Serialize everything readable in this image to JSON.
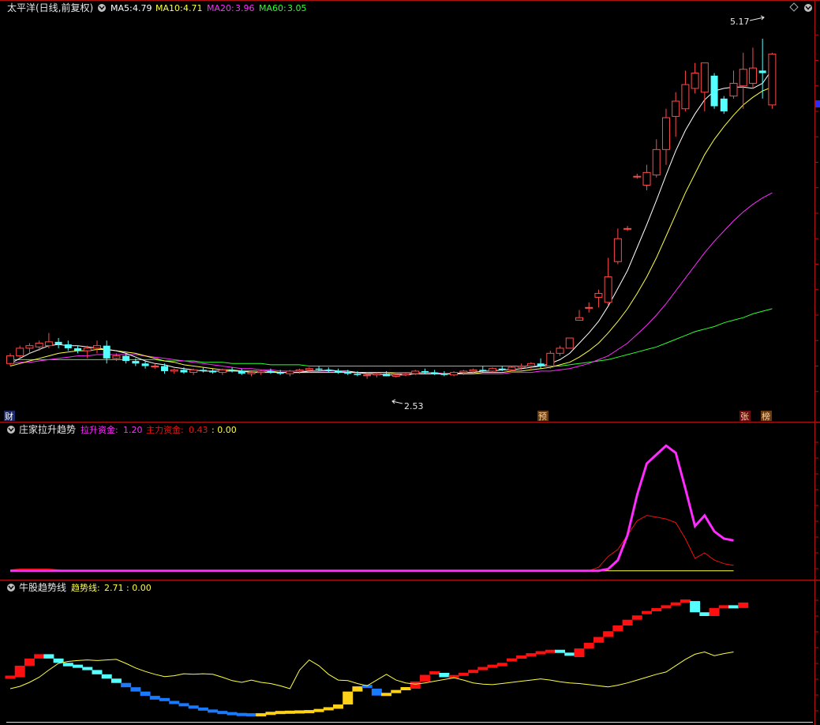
{
  "colors": {
    "up": "#ff4a4a",
    "down": "#54ffff",
    "ma5": "#ffffff",
    "ma10": "#ffff40",
    "ma20": "#ff2bff",
    "ma60": "#2bff2b",
    "grid": "#b01010",
    "pull": "#ff2bff",
    "main": "#ee1111",
    "zero": "#ffff40",
    "trend": "#ffff40"
  },
  "main_panel": {
    "title": "太平洋(日线,前复权)",
    "ma5_label": "MA5:",
    "ma5_value": "4.79",
    "ma10_label": "MA10:",
    "ma10_value": "4.71",
    "ma20_label": "MA20:",
    "ma20_value": "3.96",
    "ma60_label": "MA60:",
    "ma60_value": "3.05",
    "high_annotation": "5.17",
    "low_annotation": "2.53",
    "badge_cai": "财",
    "badge_yu": "预",
    "badge_zhang": "张",
    "badge_bang": "榜"
  },
  "indicator1": {
    "title": "庄家拉升趋势",
    "pull_label": "拉升资金:",
    "pull_value": "1.20",
    "main_label": "主力资金:",
    "main_value": "0.43",
    "zero_text": ": 0.00"
  },
  "indicator2": {
    "title": "牛股趋势线",
    "trend_label": "趋势线:",
    "trend_value": "2.71",
    "zero_text": ": 0.00"
  },
  "chart_data": [
    {
      "type": "candlestick",
      "title": "太平洋(日线,前复权)",
      "ylim": [
        2.2,
        5.35
      ],
      "ohlc": [
        [
          2.62,
          2.7,
          2.6,
          2.68
        ],
        [
          2.68,
          2.76,
          2.66,
          2.74
        ],
        [
          2.74,
          2.78,
          2.7,
          2.76
        ],
        [
          2.75,
          2.8,
          2.72,
          2.78
        ],
        [
          2.76,
          2.86,
          2.74,
          2.79
        ],
        [
          2.79,
          2.82,
          2.74,
          2.77
        ],
        [
          2.77,
          2.8,
          2.72,
          2.74
        ],
        [
          2.74,
          2.76,
          2.7,
          2.72
        ],
        [
          2.72,
          2.76,
          2.66,
          2.74
        ],
        [
          2.74,
          2.8,
          2.7,
          2.76
        ],
        [
          2.76,
          2.8,
          2.62,
          2.66
        ],
        [
          2.66,
          2.7,
          2.64,
          2.68
        ],
        [
          2.68,
          2.7,
          2.62,
          2.64
        ],
        [
          2.64,
          2.66,
          2.6,
          2.62
        ],
        [
          2.62,
          2.64,
          2.58,
          2.6
        ],
        [
          2.6,
          2.62,
          2.58,
          2.6
        ],
        [
          2.6,
          2.62,
          2.54,
          2.56
        ],
        [
          2.56,
          2.58,
          2.54,
          2.57
        ],
        [
          2.57,
          2.59,
          2.54,
          2.55
        ],
        [
          2.55,
          2.58,
          2.53,
          2.57
        ],
        [
          2.57,
          2.59,
          2.55,
          2.56
        ],
        [
          2.56,
          2.58,
          2.54,
          2.55
        ],
        [
          2.55,
          2.58,
          2.53,
          2.57
        ],
        [
          2.57,
          2.59,
          2.55,
          2.56
        ],
        [
          2.56,
          2.58,
          2.53,
          2.54
        ],
        [
          2.54,
          2.56,
          2.52,
          2.55
        ],
        [
          2.55,
          2.57,
          2.53,
          2.56
        ],
        [
          2.56,
          2.58,
          2.54,
          2.55
        ],
        [
          2.55,
          2.57,
          2.53,
          2.54
        ],
        [
          2.54,
          2.57,
          2.52,
          2.56
        ],
        [
          2.56,
          2.58,
          2.54,
          2.57
        ],
        [
          2.57,
          2.59,
          2.55,
          2.58
        ],
        [
          2.58,
          2.6,
          2.56,
          2.57
        ],
        [
          2.57,
          2.59,
          2.55,
          2.56
        ],
        [
          2.56,
          2.58,
          2.54,
          2.55
        ],
        [
          2.55,
          2.57,
          2.53,
          2.54
        ],
        [
          2.54,
          2.56,
          2.52,
          2.53
        ],
        [
          2.53,
          2.55,
          2.5,
          2.53
        ],
        [
          2.53,
          2.55,
          2.51,
          2.54
        ],
        [
          2.54,
          2.56,
          2.52,
          2.52
        ],
        [
          2.52,
          2.54,
          2.51,
          2.53
        ],
        [
          2.53,
          2.55,
          2.52,
          2.54
        ],
        [
          2.54,
          2.57,
          2.53,
          2.56
        ],
        [
          2.56,
          2.58,
          2.54,
          2.55
        ],
        [
          2.55,
          2.57,
          2.53,
          2.54
        ],
        [
          2.54,
          2.56,
          2.52,
          2.53
        ],
        [
          2.53,
          2.56,
          2.52,
          2.55
        ],
        [
          2.55,
          2.57,
          2.53,
          2.56
        ],
        [
          2.56,
          2.58,
          2.54,
          2.57
        ],
        [
          2.57,
          2.6,
          2.55,
          2.56
        ],
        [
          2.56,
          2.59,
          2.55,
          2.58
        ],
        [
          2.58,
          2.6,
          2.56,
          2.57
        ],
        [
          2.57,
          2.6,
          2.56,
          2.59
        ],
        [
          2.59,
          2.62,
          2.57,
          2.6
        ],
        [
          2.6,
          2.63,
          2.58,
          2.62
        ],
        [
          2.62,
          2.66,
          2.58,
          2.6
        ],
        [
          2.6,
          2.72,
          2.58,
          2.7
        ],
        [
          2.7,
          2.76,
          2.68,
          2.74
        ],
        [
          2.74,
          2.82,
          2.74,
          2.82
        ],
        [
          2.96,
          3.04,
          2.96,
          2.98
        ],
        [
          3.06,
          3.1,
          3.02,
          3.06
        ],
        [
          3.14,
          3.2,
          3.06,
          3.17
        ],
        [
          3.1,
          3.45,
          3.08,
          3.3
        ],
        [
          3.42,
          3.68,
          3.4,
          3.6
        ],
        [
          3.68,
          3.7,
          3.66,
          3.68
        ],
        [
          4.09,
          4.11,
          4.07,
          4.09
        ],
        [
          4.02,
          4.18,
          3.98,
          4.12
        ],
        [
          4.1,
          4.38,
          4.08,
          4.3
        ],
        [
          4.3,
          4.62,
          4.18,
          4.55
        ],
        [
          4.56,
          4.75,
          4.4,
          4.68
        ],
        [
          4.62,
          4.92,
          4.6,
          4.81
        ],
        [
          4.78,
          4.98,
          4.74,
          4.9
        ],
        [
          4.75,
          4.95,
          4.6,
          4.98
        ],
        [
          4.88,
          4.9,
          4.62,
          4.64
        ],
        [
          4.7,
          4.72,
          4.58,
          4.6
        ],
        [
          4.72,
          4.92,
          4.7,
          4.82
        ],
        [
          4.8,
          5.06,
          4.62,
          4.93
        ],
        [
          4.82,
          5.1,
          4.78,
          4.94
        ],
        [
          4.92,
          5.17,
          4.7,
          4.9
        ],
        [
          4.65,
          5.06,
          4.62,
          5.05
        ]
      ],
      "ma5": [
        2.62,
        2.66,
        2.7,
        2.73,
        2.76,
        2.77,
        2.76,
        2.76,
        2.75,
        2.74,
        2.73,
        2.72,
        2.7,
        2.67,
        2.64,
        2.62,
        2.61,
        2.59,
        2.58,
        2.57,
        2.56,
        2.56,
        2.56,
        2.56,
        2.56,
        2.55,
        2.55,
        2.55,
        2.55,
        2.55,
        2.55,
        2.56,
        2.56,
        2.57,
        2.56,
        2.56,
        2.55,
        2.54,
        2.54,
        2.53,
        2.53,
        2.53,
        2.54,
        2.54,
        2.54,
        2.54,
        2.54,
        2.55,
        2.55,
        2.56,
        2.56,
        2.57,
        2.57,
        2.58,
        2.59,
        2.6,
        2.62,
        2.65,
        2.7,
        2.78,
        2.86,
        2.95,
        3.07,
        3.21,
        3.35,
        3.53,
        3.71,
        3.9,
        4.1,
        4.29,
        4.45,
        4.58,
        4.69,
        4.76,
        4.78,
        4.79,
        4.79,
        4.78,
        4.82,
        4.93
      ],
      "ma10": [
        2.6,
        2.62,
        2.64,
        2.66,
        2.68,
        2.7,
        2.71,
        2.72,
        2.72,
        2.73,
        2.73,
        2.72,
        2.71,
        2.7,
        2.68,
        2.66,
        2.64,
        2.63,
        2.61,
        2.6,
        2.59,
        2.58,
        2.57,
        2.57,
        2.56,
        2.56,
        2.56,
        2.56,
        2.55,
        2.55,
        2.55,
        2.55,
        2.55,
        2.55,
        2.55,
        2.55,
        2.55,
        2.55,
        2.55,
        2.55,
        2.54,
        2.54,
        2.54,
        2.54,
        2.54,
        2.54,
        2.54,
        2.54,
        2.54,
        2.55,
        2.55,
        2.55,
        2.56,
        2.56,
        2.57,
        2.58,
        2.59,
        2.61,
        2.63,
        2.67,
        2.72,
        2.78,
        2.86,
        2.95,
        3.05,
        3.17,
        3.3,
        3.45,
        3.62,
        3.79,
        3.96,
        4.11,
        4.26,
        4.38,
        4.48,
        4.57,
        4.65,
        4.71,
        4.76,
        4.79
      ],
      "ma20": [
        2.62,
        2.63,
        2.63,
        2.64,
        2.65,
        2.66,
        2.67,
        2.68,
        2.68,
        2.69,
        2.69,
        2.69,
        2.69,
        2.69,
        2.68,
        2.67,
        2.66,
        2.65,
        2.64,
        2.63,
        2.62,
        2.61,
        2.6,
        2.59,
        2.58,
        2.58,
        2.57,
        2.57,
        2.56,
        2.56,
        2.56,
        2.56,
        2.56,
        2.56,
        2.56,
        2.55,
        2.55,
        2.55,
        2.55,
        2.55,
        2.55,
        2.55,
        2.55,
        2.55,
        2.55,
        2.54,
        2.54,
        2.54,
        2.54,
        2.54,
        2.54,
        2.54,
        2.55,
        2.55,
        2.55,
        2.56,
        2.56,
        2.57,
        2.58,
        2.6,
        2.62,
        2.65,
        2.68,
        2.73,
        2.78,
        2.85,
        2.92,
        3.0,
        3.09,
        3.19,
        3.29,
        3.39,
        3.49,
        3.58,
        3.66,
        3.74,
        3.81,
        3.87,
        3.92,
        3.96
      ],
      "ma60": [
        2.65,
        2.65,
        2.65,
        2.65,
        2.65,
        2.65,
        2.65,
        2.65,
        2.65,
        2.65,
        2.65,
        2.65,
        2.65,
        2.65,
        2.65,
        2.65,
        2.64,
        2.64,
        2.64,
        2.64,
        2.63,
        2.63,
        2.63,
        2.62,
        2.62,
        2.62,
        2.62,
        2.61,
        2.61,
        2.61,
        2.61,
        2.6,
        2.6,
        2.6,
        2.6,
        2.6,
        2.6,
        2.6,
        2.6,
        2.6,
        2.6,
        2.6,
        2.6,
        2.6,
        2.6,
        2.6,
        2.6,
        2.6,
        2.6,
        2.6,
        2.6,
        2.6,
        2.6,
        2.6,
        2.6,
        2.6,
        2.6,
        2.6,
        2.61,
        2.62,
        2.63,
        2.64,
        2.65,
        2.67,
        2.69,
        2.71,
        2.73,
        2.75,
        2.78,
        2.81,
        2.84,
        2.87,
        2.89,
        2.91,
        2.94,
        2.96,
        2.98,
        3.01,
        3.03,
        3.05
      ]
    },
    {
      "type": "line",
      "title": "庄家拉升趋势",
      "ylim": [
        -0.02,
        1.5
      ],
      "series": [
        {
          "name": "拉升资金",
          "values": [
            0,
            0,
            0,
            0,
            0,
            0,
            0,
            0,
            0,
            0,
            0,
            0,
            0,
            0,
            0,
            0,
            0,
            0,
            0,
            0,
            0,
            0,
            0,
            0,
            0,
            0,
            0,
            0,
            0,
            0,
            0,
            0,
            0,
            0,
            0,
            0,
            0,
            0,
            0,
            0,
            0,
            0,
            0,
            0,
            0,
            0,
            0,
            0,
            0,
            0,
            0,
            0,
            0,
            0,
            0,
            0,
            0,
            0,
            0,
            0,
            0,
            0,
            0.02,
            0.12,
            0.4,
            0.85,
            1.2,
            1.3,
            1.4,
            1.32,
            0.92,
            0.5,
            0.62,
            0.44,
            0.36,
            0.34
          ]
        },
        {
          "name": "主力资金",
          "values": [
            0.01,
            0.02,
            0.02,
            0.02,
            0.02,
            0.01,
            0,
            0,
            0,
            0,
            0,
            0,
            0,
            0,
            0,
            0,
            0,
            0,
            0,
            0,
            0,
            0,
            0,
            0,
            0,
            0,
            0,
            0,
            0,
            0,
            0,
            0,
            0,
            0,
            0,
            0,
            0,
            0,
            0,
            0,
            0,
            0,
            0,
            0,
            0,
            0,
            0,
            0,
            0,
            0,
            0,
            0,
            0,
            0,
            0,
            0,
            0,
            0,
            0,
            0,
            0,
            0.04,
            0.16,
            0.24,
            0.4,
            0.56,
            0.62,
            0.6,
            0.58,
            0.54,
            0.36,
            0.14,
            0.2,
            0.12,
            0.08,
            0.06
          ]
        }
      ]
    },
    {
      "type": "bar+line",
      "title": "牛股趋势线",
      "ylim": [
        -1.2,
        3.2
      ],
      "bar_values": [
        0.3,
        0.7,
        0.95,
        1.1,
        0.95,
        0.8,
        0.68,
        0.6,
        0.55,
        0.4,
        0.25,
        0.1,
        -0.05,
        -0.2,
        -0.35,
        -0.48,
        -0.58,
        -0.66,
        -0.74,
        -0.81,
        -0.88,
        -0.93,
        -0.97,
        -1.0,
        -1.01,
        -1.02,
        -1.01,
        -0.96,
        -0.93,
        -0.92,
        -0.91,
        -0.9,
        -0.86,
        -0.8,
        -0.65,
        -0.2,
        -0.02,
        -0.1,
        -0.34,
        -0.3,
        -0.2,
        -0.1,
        0.15,
        0.38,
        0.45,
        0.3,
        0.32,
        0.4,
        0.5,
        0.6,
        0.68,
        0.8,
        0.9,
        1.0,
        1.08,
        1.15,
        1.2,
        1.1,
        1.0,
        1.3,
        1.5,
        1.7,
        1.9,
        2.1,
        2.3,
        2.45,
        2.55,
        2.65,
        2.75,
        2.85,
        2.95,
        2.56,
        2.43,
        2.71,
        2.75,
        2.71,
        2.9
      ],
      "trend_line": [
        -0.1,
        -0.02,
        0.12,
        0.3,
        0.55,
        0.78,
        0.85,
        0.88,
        0.9,
        0.88,
        0.9,
        0.92,
        0.78,
        0.62,
        0.5,
        0.4,
        0.32,
        0.35,
        0.42,
        0.4,
        0.42,
        0.4,
        0.3,
        0.18,
        0.12,
        0.2,
        0.12,
        0.08,
        0.0,
        -0.1,
        0.55,
        0.9,
        0.7,
        0.4,
        0.2,
        0.18,
        0.08,
        0.0,
        0.2,
        0.4,
        0.2,
        0.1,
        0.06,
        0.1,
        0.16,
        0.22,
        0.28,
        0.2,
        0.1,
        0.06,
        0.04,
        0.08,
        0.12,
        0.16,
        0.2,
        0.24,
        0.2,
        0.14,
        0.1,
        0.08,
        0.04,
        0.0,
        -0.04,
        0.02,
        0.1,
        0.2,
        0.3,
        0.4,
        0.48,
        0.7,
        0.92,
        1.1,
        1.18,
        1.05,
        1.12,
        1.18
      ]
    }
  ]
}
